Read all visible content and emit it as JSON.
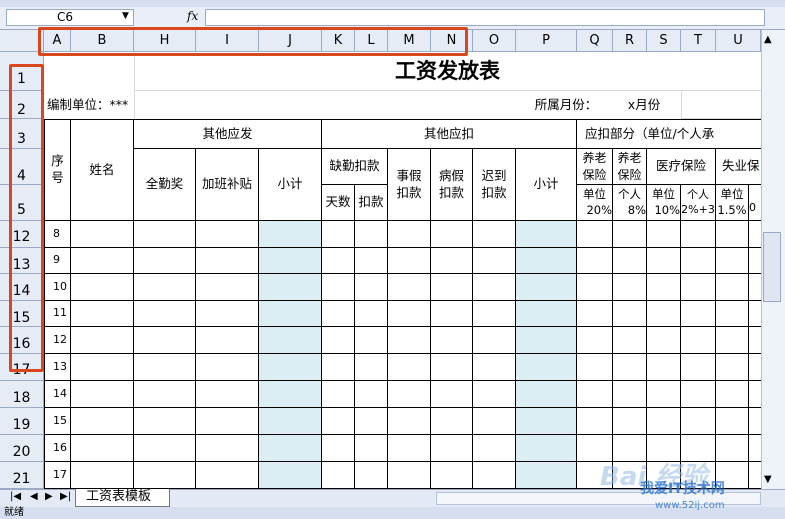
{
  "formula_bar": {
    "name_box": "C6",
    "fx_label": "fx"
  },
  "column_headers": [
    "A",
    "B",
    "H",
    "I",
    "J",
    "K",
    "L",
    "M",
    "N",
    "O",
    "P",
    "Q",
    "R",
    "S",
    "T",
    "U"
  ],
  "row_headers": [
    "1",
    "2",
    "3",
    "4",
    "5",
    "12",
    "13",
    "14",
    "15",
    "16",
    "17",
    "18",
    "19",
    "20",
    "21"
  ],
  "sheet": {
    "title": "工资发放表",
    "unit_label": "编制单位：***",
    "month_label": "所属月份：",
    "month_value": "x月份",
    "seq_header": "序号",
    "name_header": "姓名",
    "group_other_pay": "其他应发",
    "group_other_deduct": "其他应扣",
    "group_deduct_part": "应扣部分（单位/个人承",
    "full_attendance": "全勤奖",
    "overtime": "加班补贴",
    "subtotal": "小计",
    "absence": "缺勤扣款",
    "days": "天数",
    "deduct": "扣款",
    "personal_leave": "事假扣款",
    "sick_leave": "病假扣款",
    "late": "迟到扣款",
    "subtotal2": "小计",
    "pension1": "养老保险",
    "pension2": "养老保险",
    "medical": "医疗保险",
    "unemployment": "失业保",
    "unit1": "单位",
    "rate1": "20%",
    "personal1": "个人",
    "rate2": "8%",
    "unit2": "单位",
    "rate3": "10%",
    "personal2": "个人",
    "rate4": "2%+3",
    "unit3": "单位",
    "rate5": "1.5%",
    "rate6": "0",
    "seq_values": [
      "8",
      "9",
      "10",
      "11",
      "12",
      "13",
      "14",
      "15",
      "16",
      "17"
    ]
  },
  "sheet_tab": "工资表模板",
  "status_text": "就绪",
  "watermark": {
    "main": "Bai 经验",
    "sub": "我爱IT技术网",
    "url": "www.52ij.com"
  }
}
